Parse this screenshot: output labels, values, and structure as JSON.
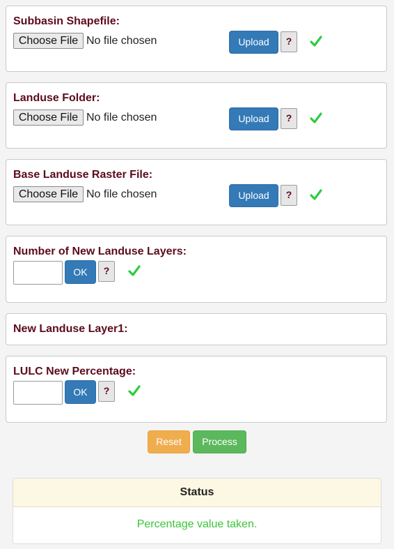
{
  "panels": {
    "subbasin": {
      "label": "Subbasin Shapefile:",
      "choose_label": "Choose File",
      "file_status": "No file chosen",
      "upload_label": "Upload",
      "help_label": "?"
    },
    "landuse_folder": {
      "label": "Landuse Folder:",
      "choose_label": "Choose File",
      "file_status": "No file chosen",
      "upload_label": "Upload",
      "help_label": "?"
    },
    "base_raster": {
      "label": "Base Landuse Raster File:",
      "choose_label": "Choose File",
      "file_status": "No file chosen",
      "upload_label": "Upload",
      "help_label": "?"
    },
    "num_layers": {
      "label": "Number of New Landuse Layers:",
      "input_value": "",
      "ok_label": "OK",
      "help_label": "?"
    },
    "new_layer": {
      "label": "New Landuse Layer1:"
    },
    "lulc_percentage": {
      "label": "LULC New Percentage:",
      "input_value": "",
      "ok_label": "OK",
      "help_label": "?"
    }
  },
  "actions": {
    "reset_label": "Reset",
    "process_label": "Process"
  },
  "status": {
    "title": "Status",
    "message": "Percentage value taken."
  },
  "colors": {
    "label": "#5c0b1c",
    "primary": "#337ab7",
    "warning": "#f0ad4e",
    "success": "#5cb85c",
    "check": "#2ecc40",
    "status_message": "#3ac43a"
  },
  "icons": {
    "check": "check-icon"
  }
}
